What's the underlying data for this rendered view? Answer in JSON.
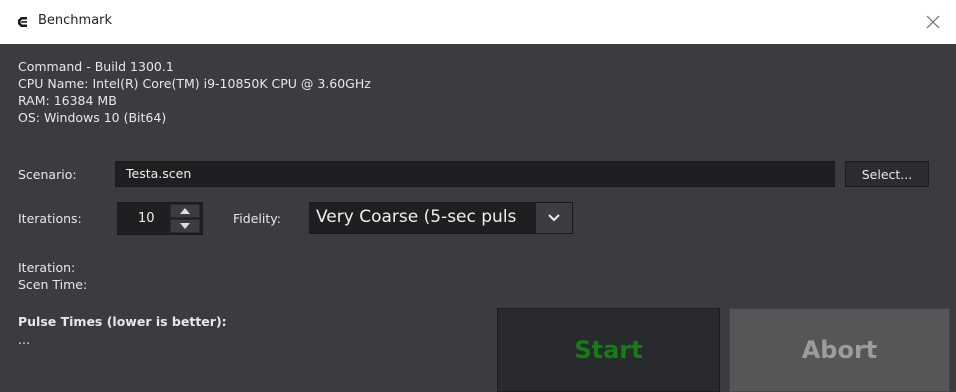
{
  "window": {
    "title": "Benchmark"
  },
  "info": {
    "command": "Command - Build 1300.1",
    "cpu": "CPU Name: Intel(R) Core(TM) i9-10850K CPU @ 3.60GHz",
    "ram": "RAM: 16384 MB",
    "os": "OS: Windows 10 (Bit64)"
  },
  "scenario": {
    "label": "Scenario:",
    "value": "Testa.scen",
    "select_label": "Select..."
  },
  "iterations": {
    "label": "Iterations:",
    "value": "10"
  },
  "fidelity": {
    "label": "Fidelity:",
    "value": "Very Coarse (5-sec puls"
  },
  "status": {
    "iteration_label": "Iteration:",
    "scen_time_label": "Scen Time:"
  },
  "pulse": {
    "heading": "Pulse Times (lower is better):",
    "value": "..."
  },
  "buttons": {
    "start": "Start",
    "abort": "Abort"
  },
  "colors": {
    "start_text": "#167d16",
    "abort_text": "#9c9c9c",
    "panel_bg": "#3a3c40"
  },
  "icons": {
    "app": "cmo-app-icon",
    "close": "close-icon",
    "spin_up": "chevron-up-icon",
    "spin_down": "chevron-down-icon",
    "combo": "chevron-down-icon"
  }
}
